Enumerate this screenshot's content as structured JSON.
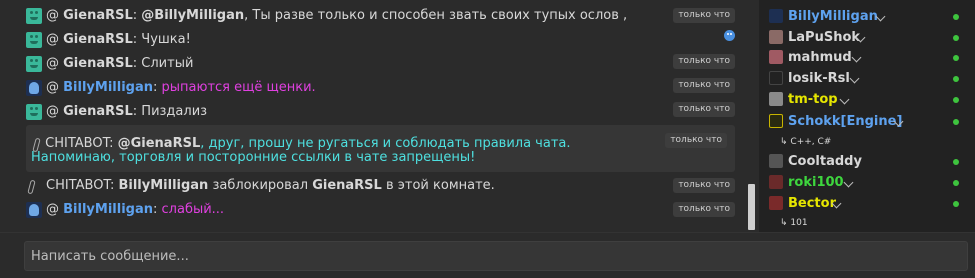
{
  "messages": [
    {
      "prefix": "@ ",
      "nick": "GienaRSL",
      "sep": ": ",
      "mention": "@BillyMilligan",
      "text": ", Ты разве только и способен звать своих тупых ослов ,",
      "time": "только что"
    },
    {
      "prefix": "@ ",
      "nick": "GienaRSL",
      "sep": ": ",
      "text": "Чушка!"
    },
    {
      "prefix": "@ ",
      "nick": "GienaRSL",
      "sep": ": ",
      "text": "Слитый",
      "time": "только что"
    },
    {
      "prefix": "@ ",
      "nick": "BillyMilligan",
      "sep": ": ",
      "text": "рыпаются ещё щенки.",
      "time": "только что"
    },
    {
      "prefix": "@ ",
      "nick": "GienaRSL",
      "sep": ": ",
      "text": "Пиздализ",
      "time": "только что"
    }
  ],
  "bot_notice": {
    "bot": "CHITABOT",
    "sep": ": ",
    "mention": "@GienaRSL",
    "line1": ", друг, прошу не ругаться и соблюдать правила чата.",
    "line2": "Напоминаю, торговля и посторонние ссылки в чате запрещены!",
    "time": "только что"
  },
  "bot_action": {
    "bot": "CHITABOT",
    "sep": ": ",
    "actor": "BillyMilligan",
    "middle": " заблокировал ",
    "target": "GienaRSL",
    "tail": " в этой комнате.",
    "time": "только что"
  },
  "last_message": {
    "prefix": "@ ",
    "nick": "BillyMilligan",
    "sep": ": ",
    "text": "слабый...",
    "time": "только что"
  },
  "users": [
    {
      "name": "BillyMilligan",
      "color": "#5ea2ef"
    },
    {
      "name": "LaPuShok",
      "color": "#d8d8d8"
    },
    {
      "name": "mahmud",
      "color": "#d8d8d8"
    },
    {
      "name": "losik-Rsl",
      "color": "#d8d8d8"
    },
    {
      "name": "tm-top",
      "color": "#e6e600"
    },
    {
      "name": "Schokk[Engine]",
      "color": "#5ea2ef",
      "sub": "C++, C#"
    },
    {
      "name": "Cooltaddy",
      "color": "#d8d8d8"
    },
    {
      "name": "roki100",
      "color": "#3ed63e"
    },
    {
      "name": "Bector",
      "color": "#e6e600",
      "sub": "101"
    }
  ],
  "composer": {
    "placeholder": "Написать сообщение..."
  },
  "colors": {
    "online": "#3ec43e",
    "nick_blue": "#5ea2ef",
    "pink": "#e040e0",
    "cyan": "#4ee0e0",
    "yellow": "#e6e600",
    "green": "#3ed63e"
  },
  "icons": {
    "emoji": "emoji-icon",
    "chevron": "chevron-down-icon",
    "online": "online-dot-icon"
  }
}
